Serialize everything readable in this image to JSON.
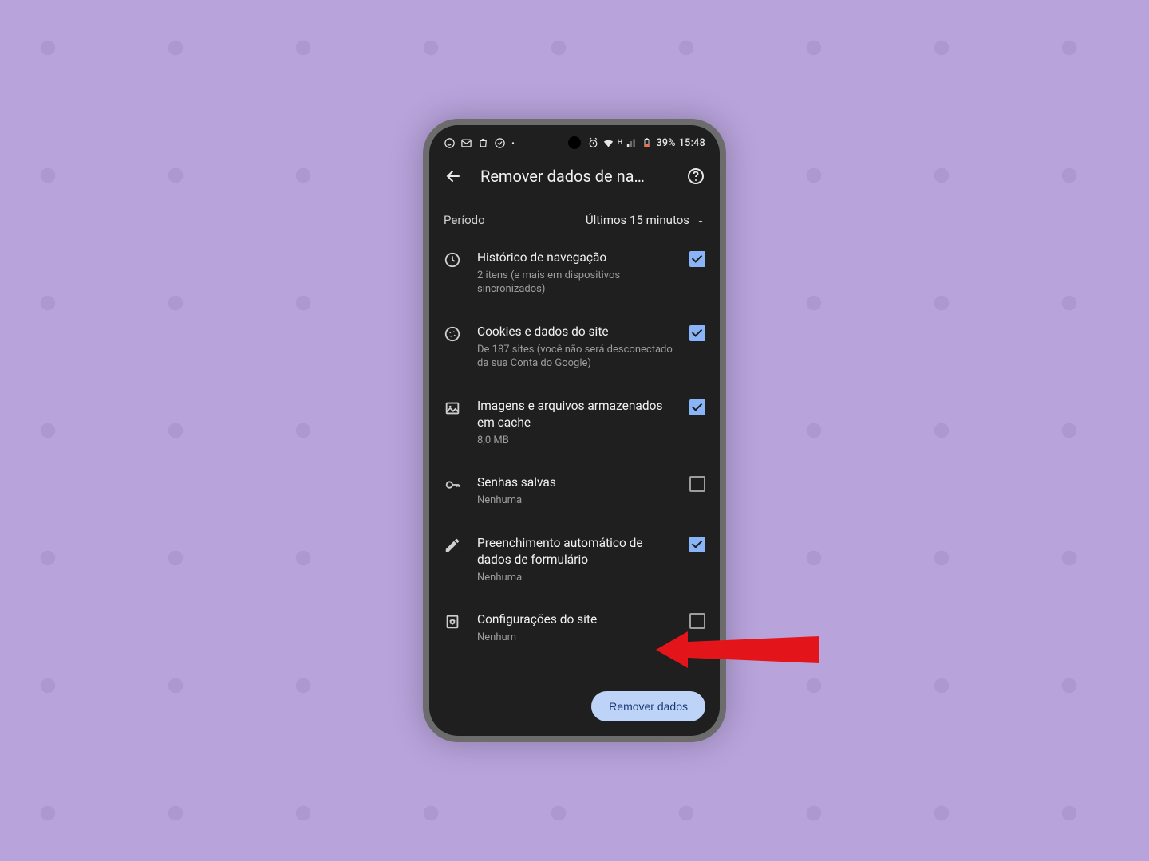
{
  "statusbar": {
    "battery_text": "39%",
    "time": "15:48",
    "network_label": "H"
  },
  "header": {
    "title": "Remover dados de na…"
  },
  "period": {
    "label": "Período",
    "value": "Últimos 15 minutos"
  },
  "items": [
    {
      "icon": "history-icon",
      "title": "Histórico de navegação",
      "subtitle": "2 itens (e mais em dispositivos sincronizados)",
      "checked": true
    },
    {
      "icon": "cookie-icon",
      "title": "Cookies e dados do site",
      "subtitle": "De 187 sites (você não será desconectado da sua Conta do Google)",
      "checked": true
    },
    {
      "icon": "image-icon",
      "title": "Imagens e arquivos armazenados em cache",
      "subtitle": "8,0 MB",
      "checked": true
    },
    {
      "icon": "key-icon",
      "title": "Senhas salvas",
      "subtitle": "Nenhuma",
      "checked": false
    },
    {
      "icon": "edit-icon",
      "title": "Preenchimento automático de dados de formulário",
      "subtitle": "Nenhuma",
      "checked": true
    },
    {
      "icon": "settings-page-icon",
      "title": "Configurações do site",
      "subtitle": "Nenhum",
      "checked": false
    }
  ],
  "action": {
    "label": "Remover dados"
  },
  "colors": {
    "accent": "#8ab4f8",
    "pill": "#bdd3f8",
    "bg": "#1f1f1f"
  }
}
